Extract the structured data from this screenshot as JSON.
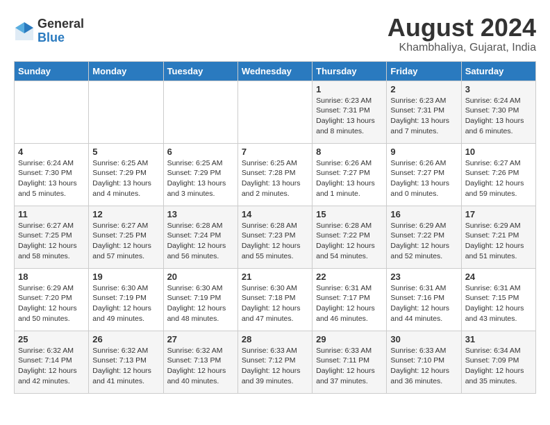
{
  "logo": {
    "general": "General",
    "blue": "Blue"
  },
  "title": {
    "month_year": "August 2024",
    "location": "Khambhaliya, Gujarat, India"
  },
  "days_of_week": [
    "Sunday",
    "Monday",
    "Tuesday",
    "Wednesday",
    "Thursday",
    "Friday",
    "Saturday"
  ],
  "weeks": [
    [
      {
        "day": "",
        "content": ""
      },
      {
        "day": "",
        "content": ""
      },
      {
        "day": "",
        "content": ""
      },
      {
        "day": "",
        "content": ""
      },
      {
        "day": "1",
        "content": "Sunrise: 6:23 AM\nSunset: 7:31 PM\nDaylight: 13 hours\nand 8 minutes."
      },
      {
        "day": "2",
        "content": "Sunrise: 6:23 AM\nSunset: 7:31 PM\nDaylight: 13 hours\nand 7 minutes."
      },
      {
        "day": "3",
        "content": "Sunrise: 6:24 AM\nSunset: 7:30 PM\nDaylight: 13 hours\nand 6 minutes."
      }
    ],
    [
      {
        "day": "4",
        "content": "Sunrise: 6:24 AM\nSunset: 7:30 PM\nDaylight: 13 hours\nand 5 minutes."
      },
      {
        "day": "5",
        "content": "Sunrise: 6:25 AM\nSunset: 7:29 PM\nDaylight: 13 hours\nand 4 minutes."
      },
      {
        "day": "6",
        "content": "Sunrise: 6:25 AM\nSunset: 7:29 PM\nDaylight: 13 hours\nand 3 minutes."
      },
      {
        "day": "7",
        "content": "Sunrise: 6:25 AM\nSunset: 7:28 PM\nDaylight: 13 hours\nand 2 minutes."
      },
      {
        "day": "8",
        "content": "Sunrise: 6:26 AM\nSunset: 7:27 PM\nDaylight: 13 hours\nand 1 minute."
      },
      {
        "day": "9",
        "content": "Sunrise: 6:26 AM\nSunset: 7:27 PM\nDaylight: 13 hours\nand 0 minutes."
      },
      {
        "day": "10",
        "content": "Sunrise: 6:27 AM\nSunset: 7:26 PM\nDaylight: 12 hours\nand 59 minutes."
      }
    ],
    [
      {
        "day": "11",
        "content": "Sunrise: 6:27 AM\nSunset: 7:25 PM\nDaylight: 12 hours\nand 58 minutes."
      },
      {
        "day": "12",
        "content": "Sunrise: 6:27 AM\nSunset: 7:25 PM\nDaylight: 12 hours\nand 57 minutes."
      },
      {
        "day": "13",
        "content": "Sunrise: 6:28 AM\nSunset: 7:24 PM\nDaylight: 12 hours\nand 56 minutes."
      },
      {
        "day": "14",
        "content": "Sunrise: 6:28 AM\nSunset: 7:23 PM\nDaylight: 12 hours\nand 55 minutes."
      },
      {
        "day": "15",
        "content": "Sunrise: 6:28 AM\nSunset: 7:22 PM\nDaylight: 12 hours\nand 54 minutes."
      },
      {
        "day": "16",
        "content": "Sunrise: 6:29 AM\nSunset: 7:22 PM\nDaylight: 12 hours\nand 52 minutes."
      },
      {
        "day": "17",
        "content": "Sunrise: 6:29 AM\nSunset: 7:21 PM\nDaylight: 12 hours\nand 51 minutes."
      }
    ],
    [
      {
        "day": "18",
        "content": "Sunrise: 6:29 AM\nSunset: 7:20 PM\nDaylight: 12 hours\nand 50 minutes."
      },
      {
        "day": "19",
        "content": "Sunrise: 6:30 AM\nSunset: 7:19 PM\nDaylight: 12 hours\nand 49 minutes."
      },
      {
        "day": "20",
        "content": "Sunrise: 6:30 AM\nSunset: 7:19 PM\nDaylight: 12 hours\nand 48 minutes."
      },
      {
        "day": "21",
        "content": "Sunrise: 6:30 AM\nSunset: 7:18 PM\nDaylight: 12 hours\nand 47 minutes."
      },
      {
        "day": "22",
        "content": "Sunrise: 6:31 AM\nSunset: 7:17 PM\nDaylight: 12 hours\nand 46 minutes."
      },
      {
        "day": "23",
        "content": "Sunrise: 6:31 AM\nSunset: 7:16 PM\nDaylight: 12 hours\nand 44 minutes."
      },
      {
        "day": "24",
        "content": "Sunrise: 6:31 AM\nSunset: 7:15 PM\nDaylight: 12 hours\nand 43 minutes."
      }
    ],
    [
      {
        "day": "25",
        "content": "Sunrise: 6:32 AM\nSunset: 7:14 PM\nDaylight: 12 hours\nand 42 minutes."
      },
      {
        "day": "26",
        "content": "Sunrise: 6:32 AM\nSunset: 7:13 PM\nDaylight: 12 hours\nand 41 minutes."
      },
      {
        "day": "27",
        "content": "Sunrise: 6:32 AM\nSunset: 7:13 PM\nDaylight: 12 hours\nand 40 minutes."
      },
      {
        "day": "28",
        "content": "Sunrise: 6:33 AM\nSunset: 7:12 PM\nDaylight: 12 hours\nand 39 minutes."
      },
      {
        "day": "29",
        "content": "Sunrise: 6:33 AM\nSunset: 7:11 PM\nDaylight: 12 hours\nand 37 minutes."
      },
      {
        "day": "30",
        "content": "Sunrise: 6:33 AM\nSunset: 7:10 PM\nDaylight: 12 hours\nand 36 minutes."
      },
      {
        "day": "31",
        "content": "Sunrise: 6:34 AM\nSunset: 7:09 PM\nDaylight: 12 hours\nand 35 minutes."
      }
    ]
  ]
}
